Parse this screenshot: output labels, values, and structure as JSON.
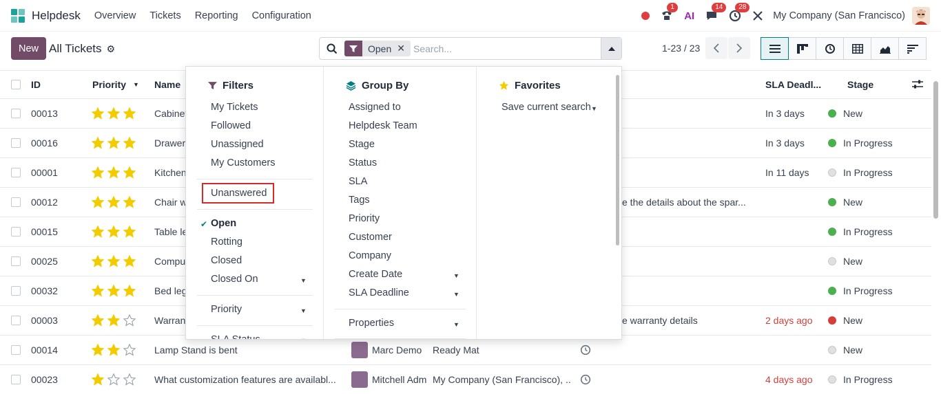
{
  "app": {
    "name": "Helpdesk",
    "menu": [
      "Overview",
      "Tickets",
      "Reporting",
      "Configuration"
    ]
  },
  "systray": {
    "phone_badge": "1",
    "chat_badge": "14",
    "activity_badge": "28",
    "ai_label": "AI",
    "company": "My Company (San Francisco)"
  },
  "control": {
    "new_label": "New",
    "title": "All Tickets",
    "facet_value": "Open",
    "search_placeholder": "Search...",
    "pager": "1-23 / 23"
  },
  "list": {
    "headers": {
      "id": "ID",
      "priority": "Priority",
      "name": "Name",
      "sla": "SLA Deadl...",
      "stage": "Stage"
    },
    "rows": [
      {
        "id": "00013",
        "stars": 3,
        "name": "Cabinet",
        "mid": "",
        "sla": "In 3 days",
        "sla_red": false,
        "dot": "#4caf50",
        "stage": "New"
      },
      {
        "id": "00016",
        "stars": 3,
        "name": "Drawer",
        "mid": "",
        "sla": "In 3 days",
        "sla_red": false,
        "dot": "#4caf50",
        "stage": "In Progress"
      },
      {
        "id": "00001",
        "stars": 3,
        "name": "Kitchen",
        "mid": "",
        "sla": "In 11 days",
        "sla_red": false,
        "dot": "#e0e0e0",
        "stage": "In Progress"
      },
      {
        "id": "00012",
        "stars": 3,
        "name": "Chair w",
        "mid": "e the details about the spar...",
        "sla": "",
        "sla_red": false,
        "dot": "#4caf50",
        "stage": "New"
      },
      {
        "id": "00015",
        "stars": 3,
        "name": "Table le",
        "mid": "",
        "sla": "",
        "sla_red": false,
        "dot": "#4caf50",
        "stage": "In Progress"
      },
      {
        "id": "00025",
        "stars": 3,
        "name": "Compu",
        "mid": "",
        "sla": "",
        "sla_red": false,
        "dot": "#e0e0e0",
        "stage": "New"
      },
      {
        "id": "00032",
        "stars": 3,
        "name": "Bed leg",
        "mid": "",
        "sla": "",
        "sla_red": false,
        "dot": "#4caf50",
        "stage": "In Progress"
      },
      {
        "id": "00003",
        "stars": 2,
        "name": "Warran",
        "mid": "e warranty details",
        "sla": "2 days ago",
        "sla_red": true,
        "dot": "#d43f3a",
        "stage": "New"
      },
      {
        "id": "00014",
        "stars": 2,
        "name": "Lamp Stand is bent",
        "assignee": "Marc Demo",
        "customer": "Ready Mat",
        "clock": true,
        "sla": "",
        "sla_red": false,
        "dot": "#e0e0e0",
        "stage": "New"
      },
      {
        "id": "00023",
        "stars": 1,
        "name": "What customization features are availabl...",
        "assignee": "Mitchell Adm",
        "customer": "My Company (San Francisco), ...",
        "clock": true,
        "sla": "4 days ago",
        "sla_red": true,
        "dot": "#e0e0e0",
        "stage": "In Progress"
      }
    ]
  },
  "dropdown": {
    "filters_title": "Filters",
    "groupby_title": "Group By",
    "favorites_title": "Favorites",
    "filters": [
      "My Tickets",
      "Followed",
      "Unassigned",
      "My Customers",
      "Unanswered",
      "Open",
      "Rotting",
      "Closed",
      "Closed On",
      "Priority",
      "SLA Status"
    ],
    "groupby": [
      "Assigned to",
      "Helpdesk Team",
      "Stage",
      "Status",
      "SLA",
      "Tags",
      "Priority",
      "Customer",
      "Company",
      "Create Date",
      "SLA Deadline",
      "Properties"
    ],
    "favorites": [
      "Save current search"
    ]
  },
  "colors": {
    "primary": "#714b67",
    "star": "#f3cc00",
    "highlight": "#d32a2a",
    "teal": "#017e84"
  }
}
